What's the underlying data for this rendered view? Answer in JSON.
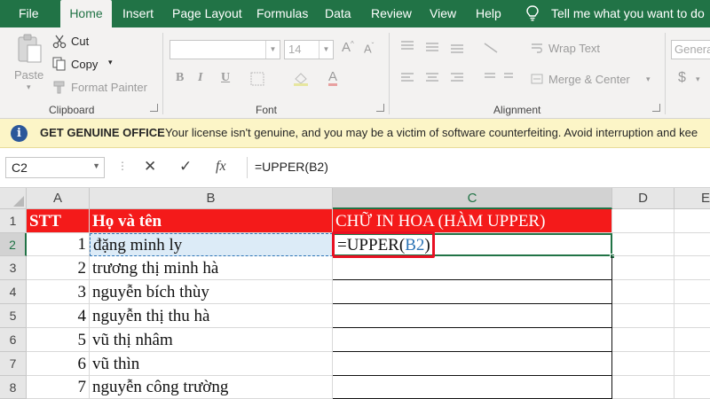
{
  "menu": {
    "tabs": [
      "File",
      "Home",
      "Insert",
      "Page Layout",
      "Formulas",
      "Data",
      "Review",
      "View",
      "Help"
    ],
    "active": "Home",
    "tell_me": "Tell me what you want to do"
  },
  "ribbon": {
    "clipboard": {
      "paste": "Paste",
      "cut": "Cut",
      "copy": "Copy",
      "format_painter": "Format Painter",
      "group_label": "Clipboard"
    },
    "font": {
      "size": "14",
      "bold": "B",
      "italic": "I",
      "underline": "U",
      "group_label": "Font"
    },
    "alignment": {
      "wrap_text": "Wrap Text",
      "merge_center": "Merge & Center",
      "group_label": "Alignment"
    },
    "number": {
      "format": "Genera",
      "currency": "$"
    }
  },
  "message_bar": {
    "title": "GET GENUINE OFFICE",
    "body": "Your license isn't genuine, and you may be a victim of software counterfeiting. Avoid interruption and kee"
  },
  "formula_bar": {
    "name_box": "C2",
    "cancel": "✕",
    "enter": "✓",
    "fx": "fx",
    "formula": "=UPPER(B2)"
  },
  "sheet": {
    "columns": [
      "A",
      "B",
      "C",
      "D",
      "E"
    ],
    "rows": [
      "1",
      "2",
      "3",
      "4",
      "5",
      "6",
      "7",
      "8"
    ],
    "header_row": {
      "A": "STT",
      "B": "Họ và tên",
      "C": "CHỮ IN HOA (HÀM UPPER)"
    },
    "data": [
      {
        "stt": "1",
        "name": "đặng minh ly"
      },
      {
        "stt": "2",
        "name": "trương thị minh hà"
      },
      {
        "stt": "3",
        "name": "nguyễn bích thùy"
      },
      {
        "stt": "4",
        "name": "nguyễn thị thu hà"
      },
      {
        "stt": "5",
        "name": "vũ thị nhâm"
      },
      {
        "stt": "6",
        "name": "vũ thìn"
      },
      {
        "stt": "7",
        "name": "nguyễn công trường"
      }
    ],
    "active_cell": {
      "prefix": "=UPPER(",
      "ref": "B2",
      "suffix": ")"
    }
  },
  "colors": {
    "excel_green": "#217346",
    "header_red": "#f41a1a",
    "message_bar": "#fcf5c7",
    "highlight_box": "#e81123",
    "ref_blue": "#2e75b6"
  }
}
